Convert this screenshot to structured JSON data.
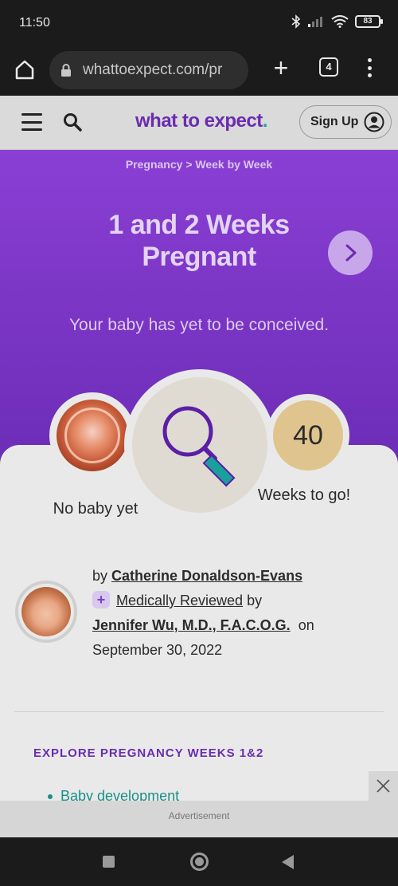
{
  "status_bar": {
    "time": "11:50",
    "battery": "83",
    "icons": [
      "bluetooth-icon",
      "signal-icon",
      "wifi-icon",
      "battery-icon"
    ]
  },
  "browser": {
    "url": "whattoexpect.com/pr",
    "tab_count": "4",
    "icons": [
      "home-icon",
      "lock-icon",
      "plus-icon",
      "tabs-icon",
      "more-vert-icon"
    ]
  },
  "site_header": {
    "logo_text": "what to expect",
    "logo_dot": ".",
    "signup_label": "Sign Up",
    "brand_color": "#6a2cb0",
    "accent_color": "#19a5a0"
  },
  "hero": {
    "breadcrumb": "Pregnancy  >  Week by Week",
    "title_line1": "1 and 2 Weeks",
    "title_line2": "Pregnant",
    "subtitle": "Your baby has yet to be conceived."
  },
  "progress": {
    "left_caption": "No baby yet",
    "weeks_number": "40",
    "right_caption": "Weeks to go!"
  },
  "author": {
    "by": "by",
    "name": "Catherine Donaldson-Evans",
    "reviewed_label": "Medically Reviewed",
    "reviewed_by": "by",
    "reviewer": "Jennifer Wu, M.D., F.A.C.O.G.",
    "on": "on",
    "date": "September 30, 2022"
  },
  "explore": {
    "heading": "EXPLORE PREGNANCY WEEKS 1&2",
    "items": [
      "Baby development"
    ]
  },
  "ad": {
    "label": "Advertisement"
  }
}
